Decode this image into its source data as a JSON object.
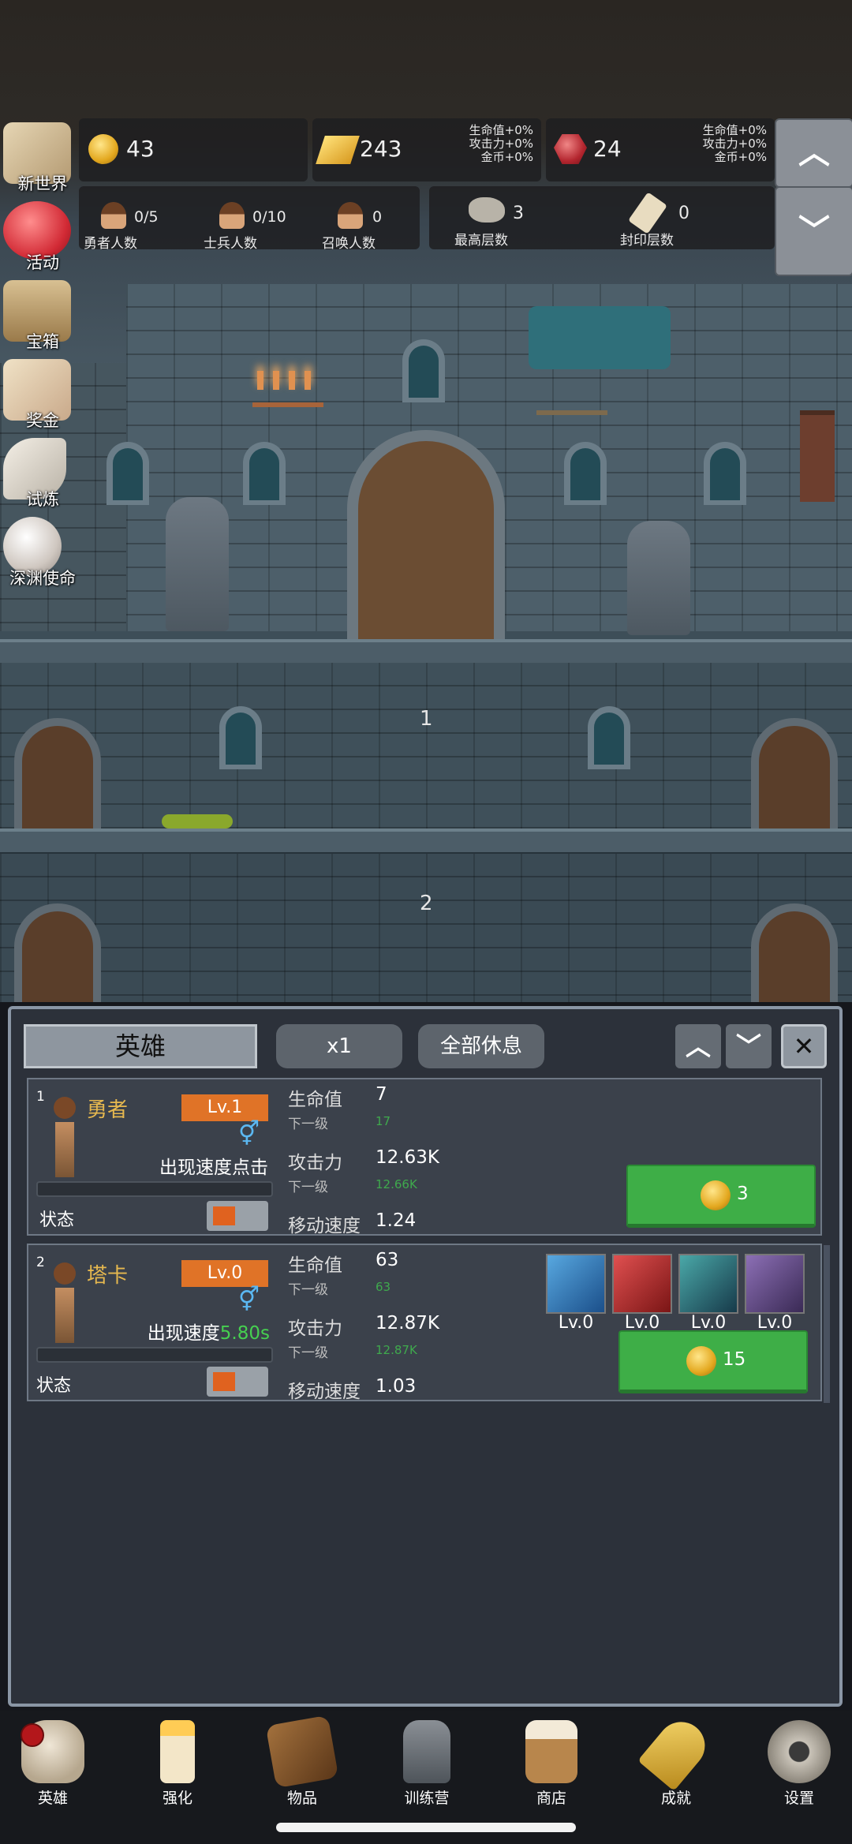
{
  "resources": {
    "gold": {
      "value": "43"
    },
    "gold_bar": {
      "value": "243",
      "bonus": [
        "生命值+0%",
        "攻击力+0%",
        "金币+0%"
      ]
    },
    "gem": {
      "value": "24",
      "bonus": [
        "生命值+0%",
        "攻击力+0%",
        "金币+0%"
      ]
    }
  },
  "counts": {
    "heroes": {
      "value": "0/5",
      "label": "勇者人数"
    },
    "soldiers": {
      "value": "0/10",
      "label": "士兵人数"
    },
    "summons": {
      "value": "0",
      "label": "召唤人数"
    },
    "max_floor": {
      "value": "3",
      "label": "最高层数"
    },
    "sealed_floor": {
      "value": "0",
      "label": "封印层数"
    }
  },
  "side_menu": [
    "新世界",
    "活动",
    "宝箱",
    "奖金",
    "试炼",
    "深渊使命"
  ],
  "floors": [
    "1",
    "2"
  ],
  "panel": {
    "tab_title": "英雄",
    "speed_btn": "x1",
    "rest_all_btn": "全部休息",
    "collapse_up": "⌃",
    "collapse_down": "⌄",
    "close": "✕"
  },
  "heroes": [
    {
      "index": "1",
      "name": "勇者",
      "level": "Lv.1",
      "gender": "⚥",
      "speed_text": "出现速度点击",
      "speed_value": "",
      "status_label": "状态",
      "hp_label": "生命值",
      "hp": "7",
      "next_label": "下一级",
      "hp_next": "17",
      "atk_label": "攻击力",
      "atk": "12.63K",
      "atk_next": "12.66K",
      "move_label": "移动速度",
      "move": "1.24",
      "cost": "3"
    },
    {
      "index": "2",
      "name": "塔卡",
      "level": "Lv.0",
      "gender": "⚥",
      "speed_text": "出现速度",
      "speed_value": "5.80s",
      "status_label": "状态",
      "hp_label": "生命值",
      "hp": "63",
      "next_label": "下一级",
      "hp_next": "63",
      "atk_label": "攻击力",
      "atk": "12.87K",
      "atk_next": "12.87K",
      "move_label": "移动速度",
      "move": "1.03",
      "cost": "15",
      "skills": [
        "Lv.0",
        "Lv.0",
        "Lv.0",
        "Lv.0"
      ]
    }
  ],
  "nav": [
    "英雄",
    "强化",
    "物品",
    "训练营",
    "商店",
    "成就",
    "设置"
  ],
  "colors": {
    "accent_green": "#3eae47",
    "level_orange": "#e07327",
    "speed_green": "#46d050",
    "name_gold": "#e6b84f"
  }
}
